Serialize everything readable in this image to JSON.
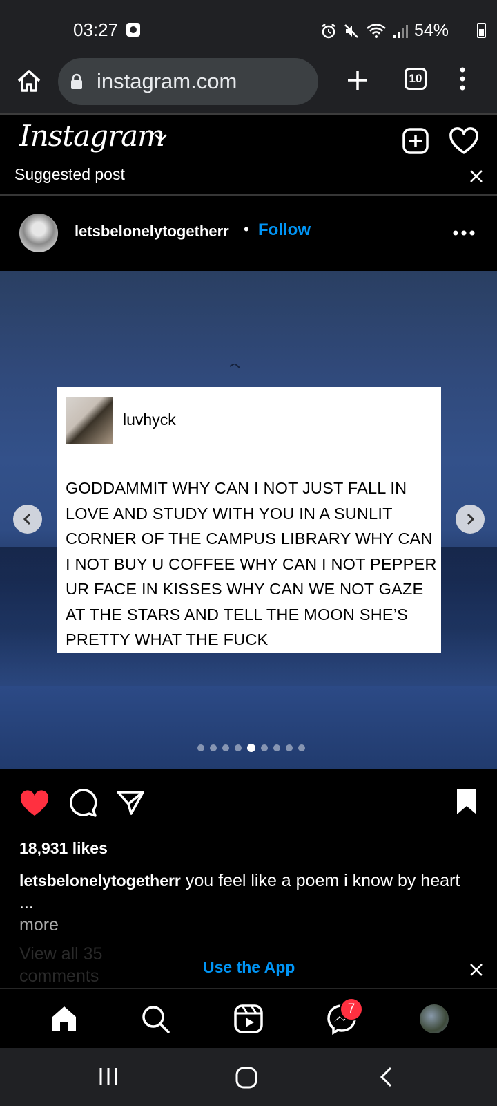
{
  "status_bar": {
    "time": "03:27",
    "battery": "54%"
  },
  "browser": {
    "url": "instagram.com",
    "tab_count": "10"
  },
  "instagram": {
    "logo": "Instagram",
    "suggested_label": "Suggested post"
  },
  "post": {
    "username": "letsbelonelytogetherr",
    "separator": "•",
    "follow_label": "Follow",
    "embedded_card": {
      "username": "luvhyck",
      "text": "GODDAMMIT WHY CAN I NOT JUST FALL IN LOVE AND STUDY WITH YOU IN A SUNLIT CORNER OF THE CAMPUS LIBRARY WHY CAN I NOT BUY U COFFEE WHY CAN I NOT PEPPER UR FACE IN KISSES WHY CAN WE NOT GAZE AT THE STARS AND TELL THE MOON SHE’S PRETTY WHAT THE FUCK"
    },
    "carousel": {
      "total": 9,
      "active_index": 4
    },
    "likes": "18,931 likes",
    "caption_username": "letsbelonelytogetherr",
    "caption_text": " you feel like a poem i know by heart ...",
    "more_label": "more",
    "view_comments": "View all 35 comments",
    "liked": true,
    "saved": true
  },
  "app_banner": {
    "label": "Use the App"
  },
  "bottom_nav": {
    "messages_badge": "7"
  },
  "colors": {
    "accent": "#0095f6",
    "like_red": "#ff3040",
    "chrome_bg": "#202124"
  }
}
